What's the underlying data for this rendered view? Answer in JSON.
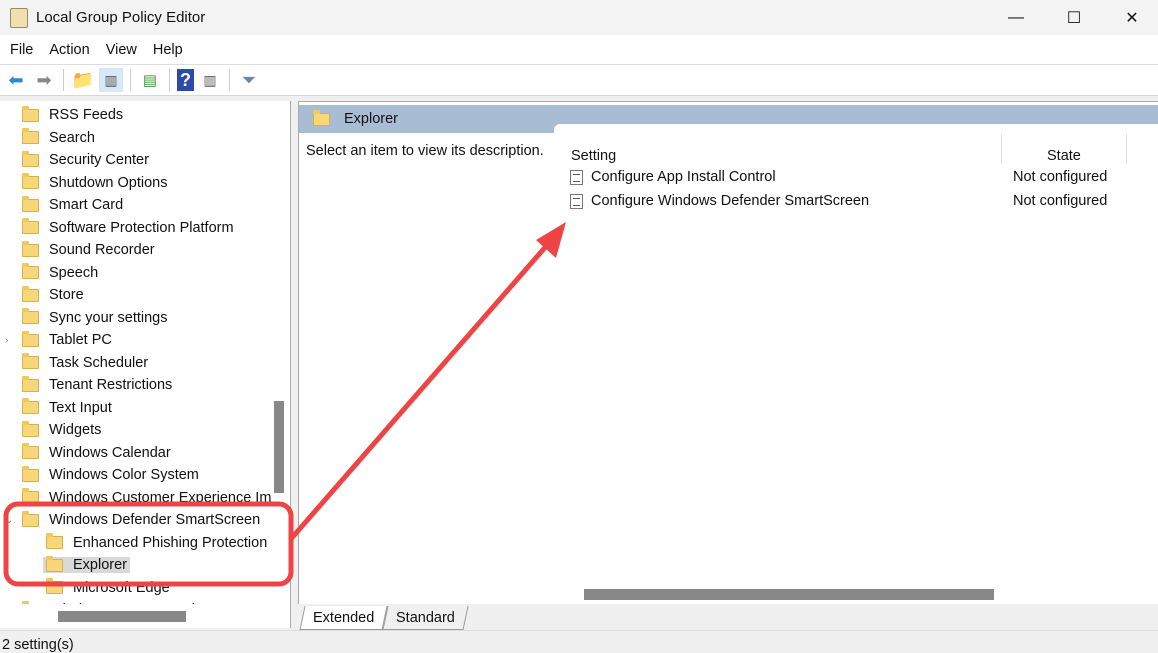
{
  "window": {
    "title": "Local Group Policy Editor",
    "minimize": "—",
    "maximize": "☐",
    "close": "✕"
  },
  "menu": [
    "File",
    "Action",
    "View",
    "Help"
  ],
  "toolbar": [
    "back",
    "forward",
    "up-folder",
    "show-hide-tree",
    "export-list",
    "help",
    "show-hide-action-pane",
    "filter"
  ],
  "tree": {
    "items": [
      {
        "label": "RSS Feeds",
        "level": 1
      },
      {
        "label": "Search",
        "level": 1
      },
      {
        "label": "Security Center",
        "level": 1
      },
      {
        "label": "Shutdown Options",
        "level": 1
      },
      {
        "label": "Smart Card",
        "level": 1
      },
      {
        "label": "Software Protection Platform",
        "level": 1
      },
      {
        "label": "Sound Recorder",
        "level": 1
      },
      {
        "label": "Speech",
        "level": 1
      },
      {
        "label": "Store",
        "level": 1
      },
      {
        "label": "Sync your settings",
        "level": 1
      },
      {
        "label": "Tablet PC",
        "level": 1,
        "expandable": true
      },
      {
        "label": "Task Scheduler",
        "level": 1
      },
      {
        "label": "Tenant Restrictions",
        "level": 1
      },
      {
        "label": "Text Input",
        "level": 1
      },
      {
        "label": "Widgets",
        "level": 1
      },
      {
        "label": "Windows Calendar",
        "level": 1
      },
      {
        "label": "Windows Color System",
        "level": 1
      },
      {
        "label": "Windows Customer Experience Im",
        "level": 1
      },
      {
        "label": "Windows Defender SmartScreen",
        "level": 1,
        "expanded": true
      },
      {
        "label": "Enhanced Phishing Protection",
        "level": 2
      },
      {
        "label": "Explorer",
        "level": 2,
        "selected": true
      },
      {
        "label": "Microsoft Edge",
        "level": 2
      },
      {
        "label": "Windows Error Reporting",
        "level": 1
      }
    ]
  },
  "right": {
    "header": "Explorer",
    "description": "Select an item to view its description.",
    "columns": {
      "setting": "Setting",
      "state": "State"
    },
    "rows": [
      {
        "setting": "Configure App Install Control",
        "state": "Not configured"
      },
      {
        "setting": "Configure Windows Defender SmartScreen",
        "state": "Not configured"
      }
    ]
  },
  "tabs": [
    "Extended",
    "Standard"
  ],
  "status": "2 setting(s)",
  "annotation_color": "#ee4444"
}
